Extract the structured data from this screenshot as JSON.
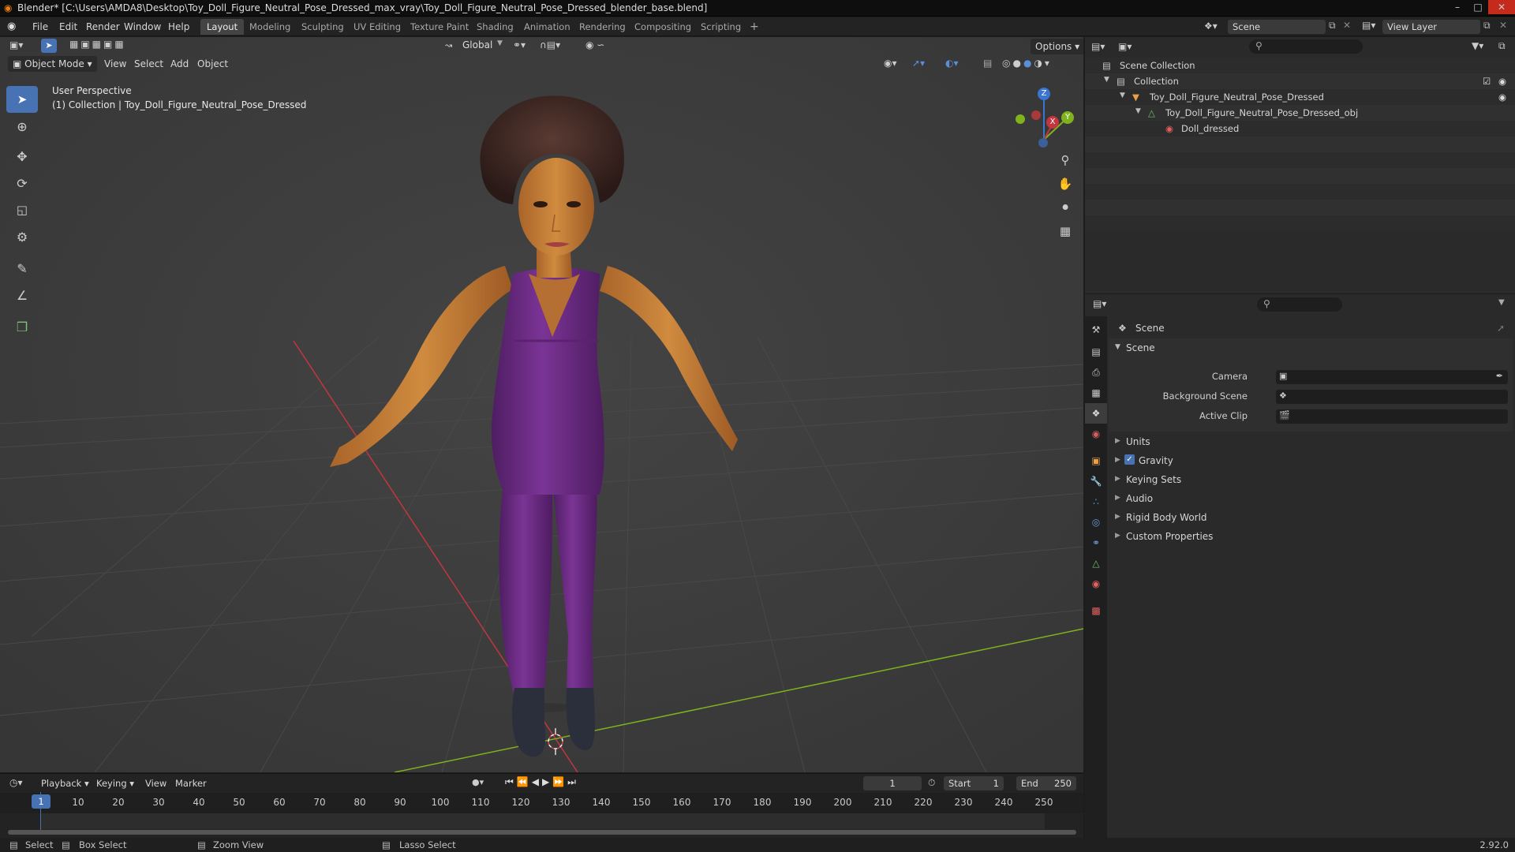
{
  "window": {
    "title": "Blender* [C:\\Users\\AMDA8\\Desktop\\Toy_Doll_Figure_Neutral_Pose_Dressed_max_vray\\Toy_Doll_Figure_Neutral_Pose_Dressed_blender_base.blend]",
    "min_glyph": "–",
    "max_glyph": "□",
    "close_glyph": "✕"
  },
  "menu": [
    "File",
    "Edit",
    "Render",
    "Window",
    "Help"
  ],
  "workspaces": [
    "Layout",
    "Modeling",
    "Sculpting",
    "UV Editing",
    "Texture Paint",
    "Shading",
    "Animation",
    "Rendering",
    "Compositing",
    "Scripting"
  ],
  "workspace_add": "+",
  "scene_name": "Scene",
  "view_layer": "View Layer",
  "viewport": {
    "transform_orientation": "Global",
    "options_label": "Options",
    "mode": "Object Mode",
    "header_menus": [
      "View",
      "Select",
      "Add",
      "Object"
    ],
    "perspective_label": "User Perspective",
    "collection_label": "(1) Collection | Toy_Doll_Figure_Neutral_Pose_Dressed",
    "gizmo_axes": {
      "x": "X",
      "y": "Y",
      "z": "Z"
    }
  },
  "outliner": {
    "scene_collection": "Scene Collection",
    "collection": "Collection",
    "object": "Toy_Doll_Figure_Neutral_Pose_Dressed",
    "mesh": "Toy_Doll_Figure_Neutral_Pose_Dressed_obj",
    "material": "Doll_dressed"
  },
  "properties": {
    "context": "Scene",
    "panel": "Scene",
    "fields": [
      {
        "label": "Camera"
      },
      {
        "label": "Background Scene"
      },
      {
        "label": "Active Clip"
      }
    ],
    "subpanels": [
      "Units",
      "Gravity",
      "Keying Sets",
      "Audio",
      "Rigid Body World",
      "Custom Properties"
    ],
    "gravity_checked": true
  },
  "timeline": {
    "menus": [
      "Playback",
      "Keying",
      "View",
      "Marker"
    ],
    "current_frame": "1",
    "start_label": "Start",
    "start": "1",
    "end_label": "End",
    "end": "250",
    "ruler": [
      "10",
      "20",
      "30",
      "40",
      "50",
      "60",
      "70",
      "80",
      "90",
      "100",
      "110",
      "120",
      "130",
      "140",
      "150",
      "160",
      "170",
      "180",
      "190",
      "200",
      "210",
      "220",
      "230",
      "240",
      "250"
    ],
    "playhead_label": "1"
  },
  "status": {
    "select": "Select",
    "box_select": "Box Select",
    "zoom_view": "Zoom View",
    "lasso_select": "Lasso Select",
    "version": "2.92.0"
  },
  "colors": {
    "accent": "#4772b3",
    "x_axis": "#c3363e",
    "y_axis": "#7fb31d",
    "z_axis": "#3a75d1",
    "outfit": "#6b2a82",
    "skin": "#c98236",
    "hair": "#3a2420"
  }
}
